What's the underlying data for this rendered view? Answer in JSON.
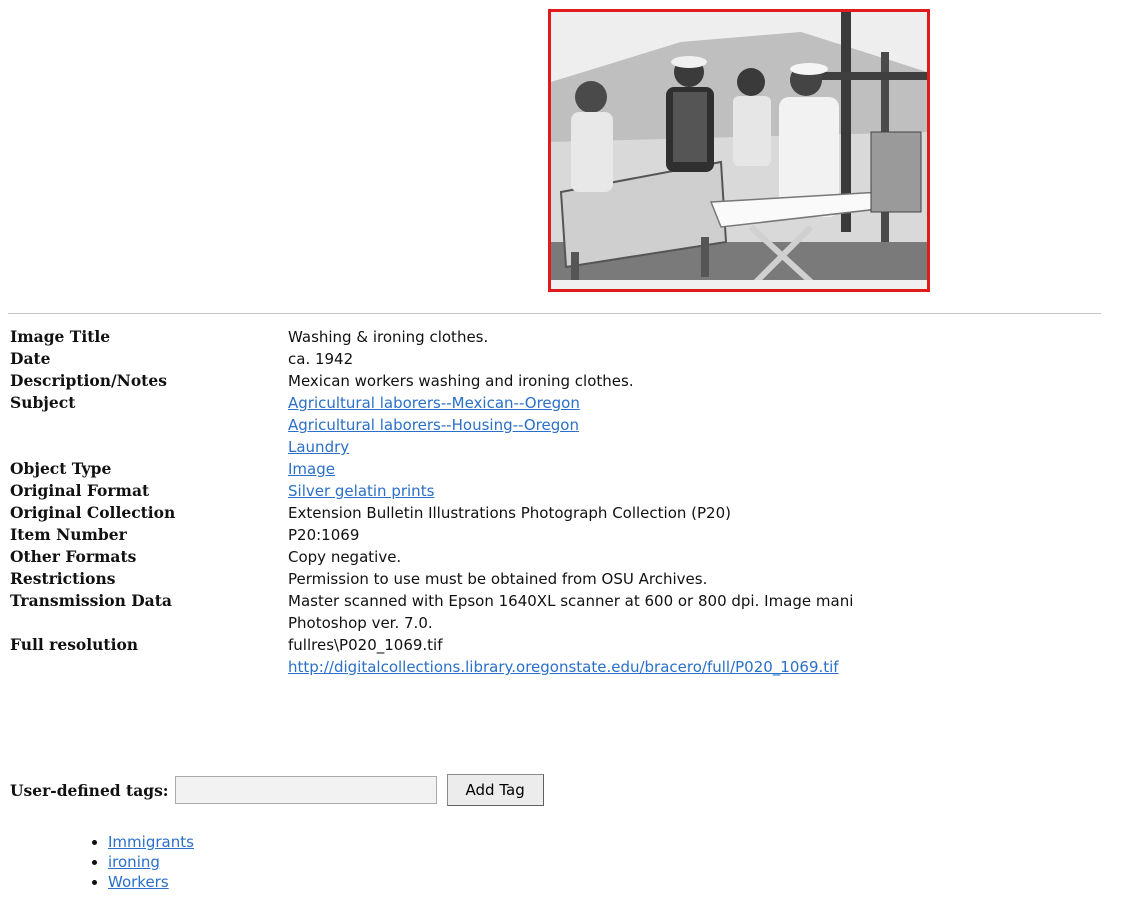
{
  "photo": {
    "alt": "Mexican workers washing and ironing clothes",
    "border_color": "#e01b1b"
  },
  "metadata": {
    "image_title": {
      "label": "Image Title",
      "value": "Washing & ironing clothes."
    },
    "date": {
      "label": "Date",
      "value": "ca. 1942"
    },
    "description": {
      "label": "Description/Notes",
      "value": "Mexican workers washing and ironing clothes."
    },
    "subject": {
      "label": "Subject",
      "links": [
        "Agricultural laborers--Mexican--Oregon",
        "Agricultural laborers--Housing--Oregon",
        "Laundry"
      ]
    },
    "object_type": {
      "label": "Object Type",
      "link": "Image"
    },
    "original_format": {
      "label": "Original Format",
      "link": "Silver gelatin prints"
    },
    "original_collection": {
      "label": "Original Collection",
      "value": "Extension Bulletin Illustrations Photograph Collection (P20)"
    },
    "item_number": {
      "label": "Item Number",
      "value": "P20:1069"
    },
    "other_formats": {
      "label": "Other Formats",
      "value": "Copy negative."
    },
    "restrictions": {
      "label": "Restrictions",
      "value": "Permission to use must be obtained from OSU Archives."
    },
    "transmission_data": {
      "label": "Transmission Data",
      "line1": "Master scanned with Epson 1640XL scanner at 600 or 800 dpi. Image mani",
      "line2": "Photoshop ver. 7.0."
    },
    "full_resolution": {
      "label": "Full resolution",
      "path": "fullres\\P020_1069.tif",
      "link": "http://digitalcollections.library.oregonstate.edu/bracero/full/P020_1069.tif"
    }
  },
  "tag_form": {
    "label": "User-defined tags:",
    "input_value": "",
    "button_label": "Add Tag"
  },
  "tags": [
    "Immigrants",
    "ironing",
    "Workers"
  ],
  "colors": {
    "link": "#2a6fc9",
    "photo_border": "#e01b1b",
    "divider": "#c8c8c8"
  }
}
